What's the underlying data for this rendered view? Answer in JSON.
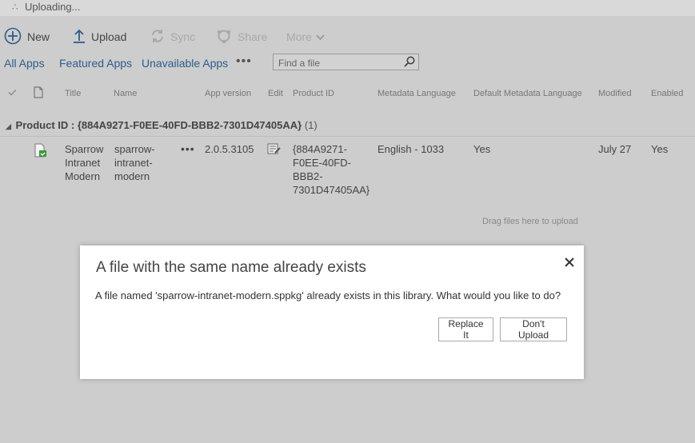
{
  "status": {
    "text": "Uploading...",
    "spinner": "∴"
  },
  "toolbar": {
    "new": "New",
    "upload": "Upload",
    "sync": "Sync",
    "share": "Share",
    "more": "More"
  },
  "views": {
    "tabs": [
      "All Apps",
      "Featured Apps",
      "Unavailable Apps"
    ],
    "more": "•••"
  },
  "search": {
    "placeholder": "Find a file"
  },
  "columns": {
    "title": "Title",
    "name": "Name",
    "app_version": "App version",
    "edit": "Edit",
    "product_id": "Product ID",
    "metadata_language": "Metadata Language",
    "default_metadata_language": "Default Metadata Language",
    "modified": "Modified",
    "enabled": "Enabled"
  },
  "group": {
    "label": "Product ID : {884A9271-F0EE-40FD-BBB2-7301D47405AA}",
    "count": "(1)"
  },
  "row": {
    "title": [
      "Sparrow",
      "Intranet",
      "Modern"
    ],
    "name": [
      "sparrow-",
      "intranet-",
      "modern"
    ],
    "dots": "•••",
    "app_version": "2.0.5.3105",
    "product_id": [
      "{884A9271-",
      "F0EE-40FD-",
      "BBB2-",
      "7301D47405AA}"
    ],
    "metadata_language": "English - 1033",
    "default_metadata_language": "Yes",
    "modified": "July 27",
    "enabled": "Yes"
  },
  "drag_hint": "Drag files here to upload",
  "dialog": {
    "title": "A file with the same name already exists",
    "message": "A file named 'sparrow-intranet-modern.sppkg' already exists in this library. What would you like to do?",
    "replace_label": "Replace It",
    "dont_upload_label": "Don't Upload"
  },
  "colors": {
    "accent": "#2b5d8c",
    "overlay": "#cdcdcd",
    "dialog_bg": "#ffffff"
  }
}
